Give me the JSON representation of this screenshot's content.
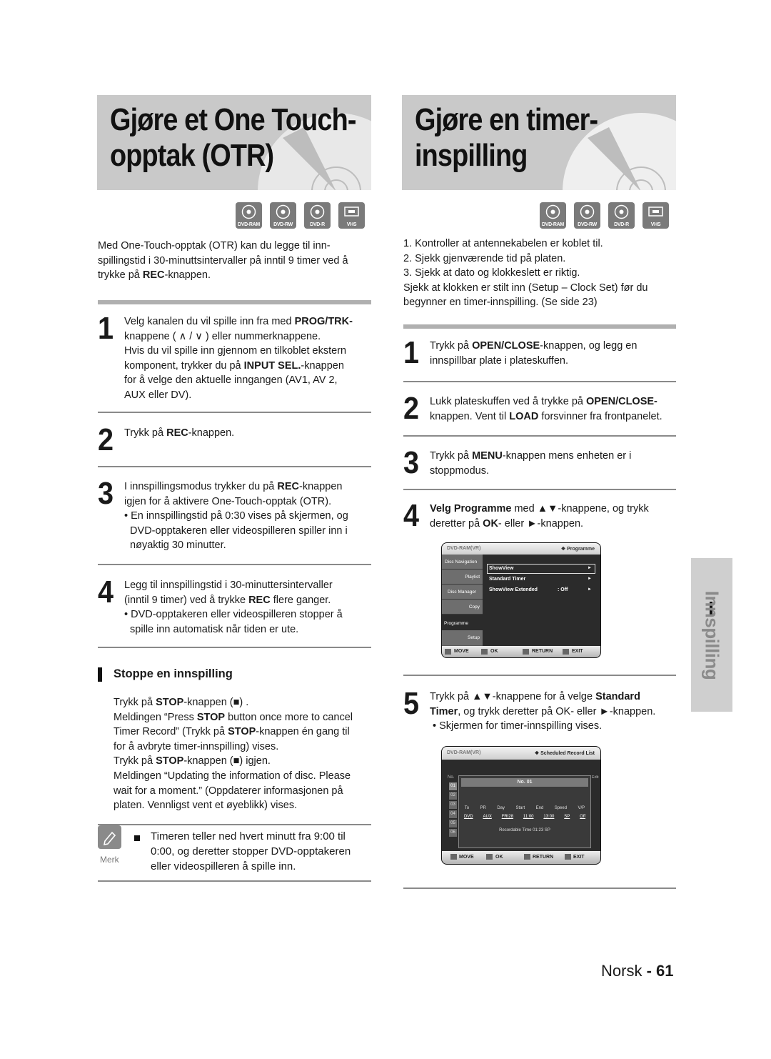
{
  "left": {
    "title_line1": "Gjøre et One Touch-",
    "title_line2": "opptak (OTR)",
    "badges": [
      "DVD-RAM",
      "DVD-RW",
      "DVD-R",
      "VHS"
    ],
    "intro": [
      "Med One-Touch-opptak (OTR) kan du legge til inn-",
      "spillingstid i 30-minuttsintervaller på inntil 9 timer ved å",
      "trykke på ",
      "REC",
      "-knappen."
    ],
    "steps": [
      {
        "num": "1",
        "lines": [
          [
            "Velg kanalen du vil spille inn fra med ",
            "PROG/TRK-",
            ""
          ],
          [
            "knappene ( ∧ / ∨ ) eller nummerknappene.",
            "",
            ""
          ],
          [
            "Hvis du vil spille inn gjennom en tilkoblet ekstern",
            "",
            ""
          ],
          [
            "komponent, trykker du på ",
            "INPUT SEL.",
            "-knappen"
          ],
          [
            "for å velge den aktuelle inngangen (AV1, AV 2,",
            "",
            ""
          ],
          [
            "AUX eller DV).",
            "",
            ""
          ]
        ]
      },
      {
        "num": "2",
        "lines": [
          [
            "Trykk på ",
            "REC",
            "-knappen."
          ]
        ]
      },
      {
        "num": "3",
        "lines": [
          [
            "I innspillingsmodus trykker du på ",
            "REC",
            "-knappen"
          ],
          [
            "igjen for å aktivere One-Touch-opptak (OTR).",
            "",
            ""
          ],
          [
            "• En innspillingstid på 0:30 vises på skjermen, og",
            "",
            ""
          ],
          [
            "  DVD-opptakeren eller videospilleren spiller inn i",
            "",
            ""
          ],
          [
            "  nøyaktig 30 minutter.",
            "",
            ""
          ]
        ]
      },
      {
        "num": "4",
        "lines": [
          [
            "Legg til innspillingstid i 30-minuttersintervaller",
            "",
            ""
          ],
          [
            "(inntil 9 timer) ved å trykke ",
            "REC",
            " flere ganger."
          ],
          [
            "• DVD-opptakeren eller videospilleren stopper å",
            "",
            ""
          ],
          [
            "  spille inn automatisk når tiden er ute.",
            "",
            ""
          ]
        ]
      }
    ],
    "stop_section": {
      "heading": "Stoppe en innspilling",
      "lines": [
        [
          "Trykk på ",
          "STOP",
          "-knappen (■) ."
        ],
        [
          "Meldingen “Press ",
          "STOP",
          " button once more to cancel"
        ],
        [
          "Timer Record” (Trykk på ",
          "STOP",
          "-knappen én gang til"
        ],
        [
          "for å avbryte timer-innspilling) vises.",
          "",
          ""
        ],
        [
          "Trykk på ",
          "STOP",
          "-knappen (■) igjen."
        ],
        [
          "Meldingen “Updating the information of disc. Please",
          "",
          ""
        ],
        [
          "wait for a moment.” (Oppdaterer informasjonen på",
          "",
          ""
        ],
        [
          "platen. Vennligst vent et øyeblikk) vises.",
          "",
          ""
        ]
      ]
    },
    "note": {
      "label": "Merk",
      "lines": [
        "Timeren teller ned hvert minutt fra 9:00 til",
        "0:00, og deretter stopper DVD-opptakeren",
        "eller videospilleren å spille inn."
      ]
    }
  },
  "right": {
    "title_line1": "Gjøre en timer-",
    "title_line2": "inspilling",
    "badges": [
      "DVD-RAM",
      "DVD-RW",
      "DVD-R",
      "VHS"
    ],
    "intro": [
      "1. Kontroller at antennekabelen er koblet til.",
      "2. Sjekk gjenværende tid på platen.",
      "3. Sjekk at dato og klokkeslett er riktig.",
      "Sjekk at klokken er stilt inn (Setup – Clock Set) før du",
      "begynner en timer-innspilling. (Se side 23)"
    ],
    "steps": [
      {
        "num": "1",
        "lines": [
          [
            "Trykk på ",
            "OPEN/CLOSE",
            "-knappen, og legg en"
          ],
          [
            "innspillbar plate i plateskuffen.",
            "",
            ""
          ]
        ]
      },
      {
        "num": "2",
        "lines": [
          [
            "Lukk plateskuffen ved å trykke på ",
            "OPEN/CLOSE-",
            ""
          ],
          [
            "knappen. Vent til ",
            "LOAD",
            " forsvinner fra frontpanelet."
          ]
        ]
      },
      {
        "num": "3",
        "lines": [
          [
            "Trykk på ",
            "MENU",
            "-knappen mens enheten er i"
          ],
          [
            "stoppmodus.",
            "",
            ""
          ]
        ]
      },
      {
        "num": "4",
        "lines": [
          [
            "",
            "Velg Programme",
            " med ▲▼-knappene, og trykk"
          ],
          [
            "deretter på ",
            "OK",
            "- eller ►-knappen."
          ]
        ]
      },
      {
        "num": "5",
        "lines": [
          [
            "Trykk på ▲▼-knappene for å velge ",
            "Standard",
            ""
          ],
          [
            "",
            "Timer",
            ", og trykk deretter på OK- eller ►-knappen."
          ],
          [
            "• Skjermen for timer-innspilling vises.",
            "",
            ""
          ]
        ]
      }
    ],
    "osd_menu": {
      "mode": "DVD-RAM(VR)",
      "section": "❖ Programme",
      "sidebar": [
        "Disc Navigation",
        "Playlist",
        "Disc Manager",
        "Copy",
        "Programme",
        "Setup"
      ],
      "items": [
        {
          "label": "ShowView",
          "value": "",
          "arrow": "►"
        },
        {
          "label": "Standard Timer",
          "value": "",
          "arrow": "►"
        },
        {
          "label": "ShowView Extended",
          "value": ": Off",
          "arrow": "►"
        }
      ],
      "footer": [
        "MOVE",
        "OK",
        "RETURN",
        "EXIT"
      ]
    },
    "osd_timer": {
      "mode": "DVD-RAM(VR)",
      "section": "❖ Scheduled Record List",
      "col_no": "No.",
      "col_edit": "Edit",
      "rows": [
        "01",
        "02",
        "03",
        "04",
        "05",
        "06"
      ],
      "dialog_title": "No. 01",
      "fields": [
        {
          "label": "To",
          "value": "DVD"
        },
        {
          "label": "PR",
          "value": "AUX"
        },
        {
          "label": "Day",
          "value": "FRI28"
        },
        {
          "label": "Start",
          "value": "11:00"
        },
        {
          "label": "End",
          "value": "13:00"
        },
        {
          "label": "Speed",
          "value": "SP"
        },
        {
          "label": "V/P",
          "value": "Off"
        }
      ],
      "recordable": "Recordable Time 01:23 SP",
      "footer": [
        "MOVE",
        "OK",
        "RETURN",
        "EXIT"
      ]
    }
  },
  "side_tab": "Innspilling",
  "footer": {
    "lang": "Norsk",
    "sep": " - ",
    "page": "61"
  }
}
